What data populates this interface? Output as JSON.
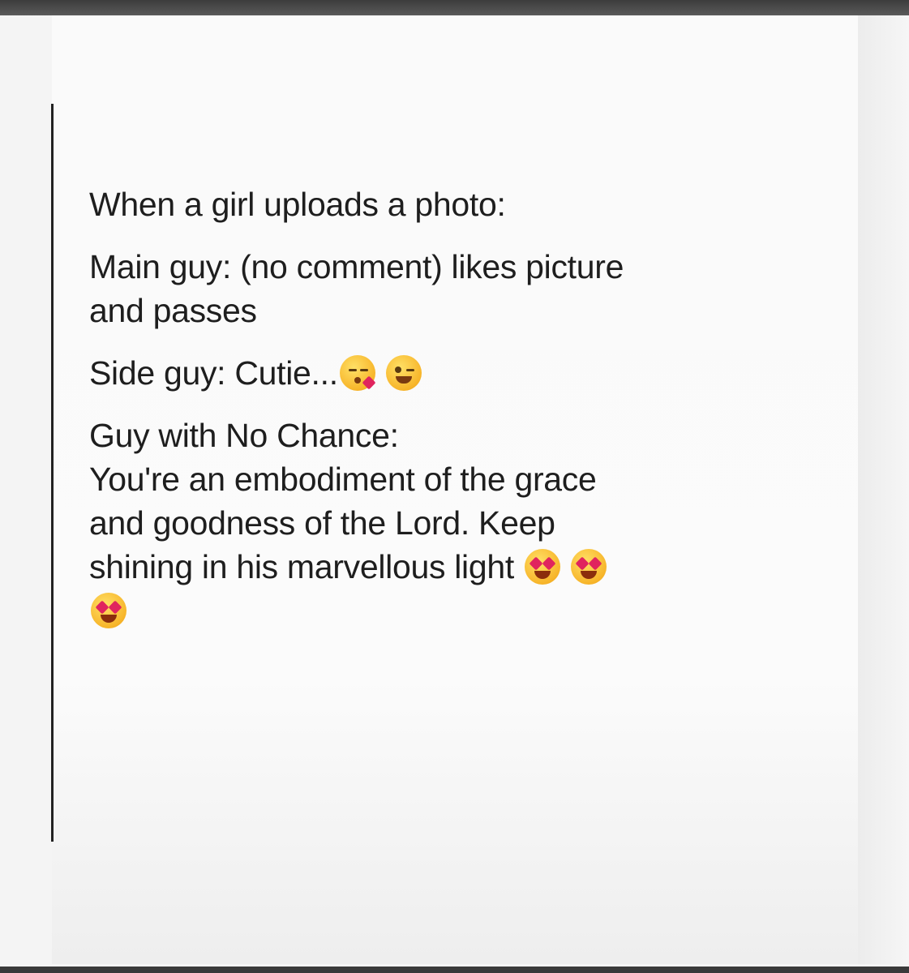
{
  "post": {
    "line1": "When a girl uploads a photo:",
    "line2a": "Main guy: (no comment) likes picture",
    "line2b": "and passes",
    "line3": "Side guy: Cutie...",
    "line4a": "Guy with No Chance:",
    "line4b": "You're an embodiment of the grace",
    "line4c": "and goodness of the Lord. Keep",
    "line4d": "shining in his marvellous light"
  },
  "emojis": {
    "side_guy": [
      "kissing-heart-emoji",
      "winking-face-emoji"
    ],
    "no_chance": [
      "heart-eyes-emoji",
      "heart-eyes-emoji",
      "heart-eyes-emoji"
    ]
  },
  "colors": {
    "text": "#1e1e1e",
    "background": "#fafafa",
    "frame_bar": "#3c3c3c"
  }
}
